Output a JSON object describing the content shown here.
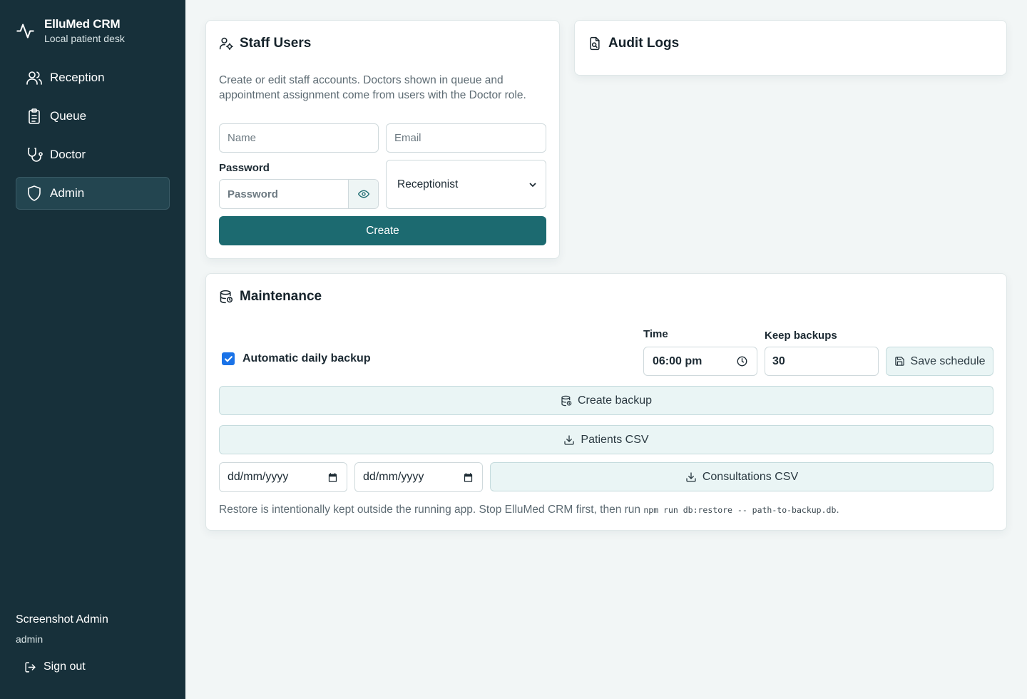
{
  "app": {
    "name": "ElluMed CRM",
    "subtitle": "Local patient desk"
  },
  "nav": [
    {
      "label": "Reception",
      "icon": "users-icon"
    },
    {
      "label": "Queue",
      "icon": "clipboard-icon"
    },
    {
      "label": "Doctor",
      "icon": "stethoscope-icon"
    },
    {
      "label": "Admin",
      "icon": "shield-icon",
      "active": true
    }
  ],
  "user": {
    "name": "Screenshot Admin",
    "role": "admin",
    "signout_label": "Sign out"
  },
  "staff": {
    "title": "Staff Users",
    "description": "Create or edit staff accounts. Doctors shown in queue and appointment assignment come from users with the Doctor role.",
    "name_placeholder": "Name",
    "email_placeholder": "Email",
    "password_label": "Password",
    "password_placeholder": "Password",
    "role_selected": "Receptionist",
    "create_label": "Create"
  },
  "audit": {
    "title": "Audit Logs"
  },
  "maintenance": {
    "title": "Maintenance",
    "auto_backup_label": "Automatic daily backup",
    "auto_backup_checked": true,
    "time_label": "Time",
    "time_value": "06:00 pm",
    "keep_label": "Keep backups",
    "keep_value": "30",
    "save_schedule_label": "Save schedule",
    "create_backup_label": "Create backup",
    "patients_csv_label": "Patients CSV",
    "date_from_placeholder": "dd/mm/yyyy",
    "date_to_placeholder": "dd/mm/yyyy",
    "consultations_csv_label": "Consultations CSV",
    "note_text": "Restore is intentionally kept outside the running app. Stop ElluMed CRM first, then run ",
    "note_code": "npm run db:restore -- path-to-backup.db",
    "note_end": "."
  },
  "colors": {
    "sidebar": "#17303a",
    "sidebar_active": "#234550",
    "primary": "#1c6a70",
    "secondary_bg": "#eaf5f5",
    "page_bg": "#f2f6f6",
    "checkbox": "#1a73e8"
  }
}
